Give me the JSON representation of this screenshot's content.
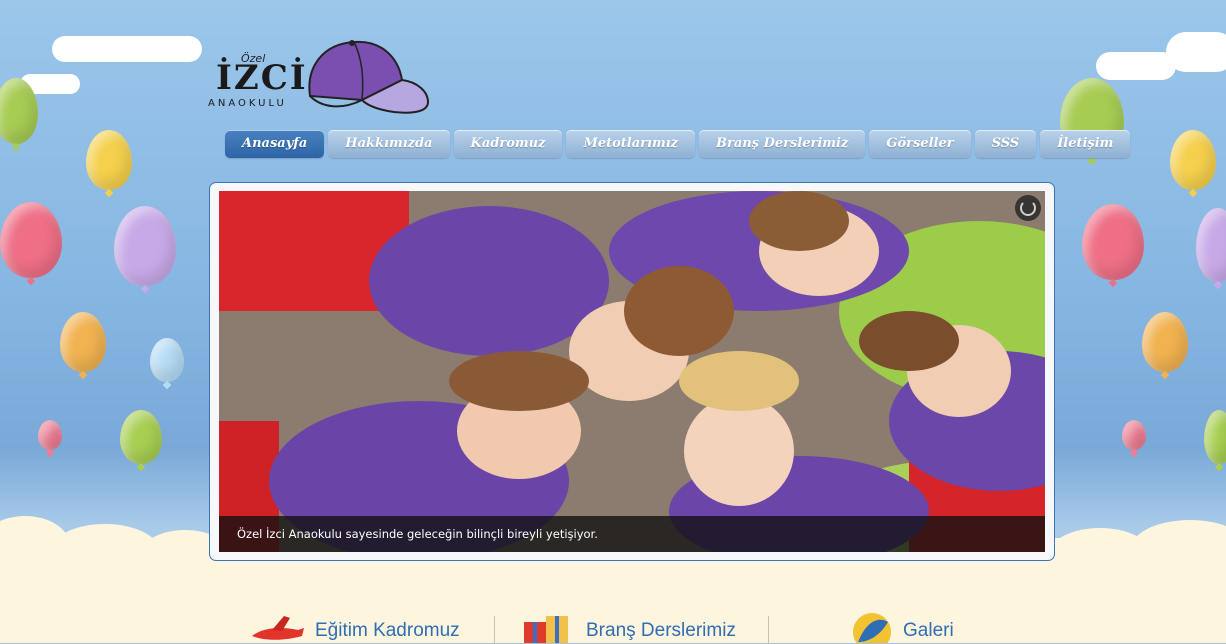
{
  "logo": {
    "ozel": "Özel",
    "izci": "İZCİ",
    "anaokulu": "ANAOKULU"
  },
  "nav": {
    "items": [
      "Anasayfa",
      "Hakkımızda",
      "Kadromuz",
      "Metotlarımız",
      "Branş Derslerimiz",
      "Görseller",
      "SSS",
      "İletişim"
    ],
    "active": "Anasayfa"
  },
  "slider": {
    "caption": "Özel İzci Anaokulu sayesinde geleceğin bilinçli bireyli yetişiyor."
  },
  "bottom_links": {
    "egitim": "Eğitim Kadromuz",
    "brans": "Branş Derslerimiz",
    "galeri": "Galeri"
  },
  "colors": {
    "nav_active": "#2c64a6",
    "nav_inactive": "#9fbcdc",
    "link": "#2f6eb4",
    "cap_purple": "#7a4fb0"
  }
}
